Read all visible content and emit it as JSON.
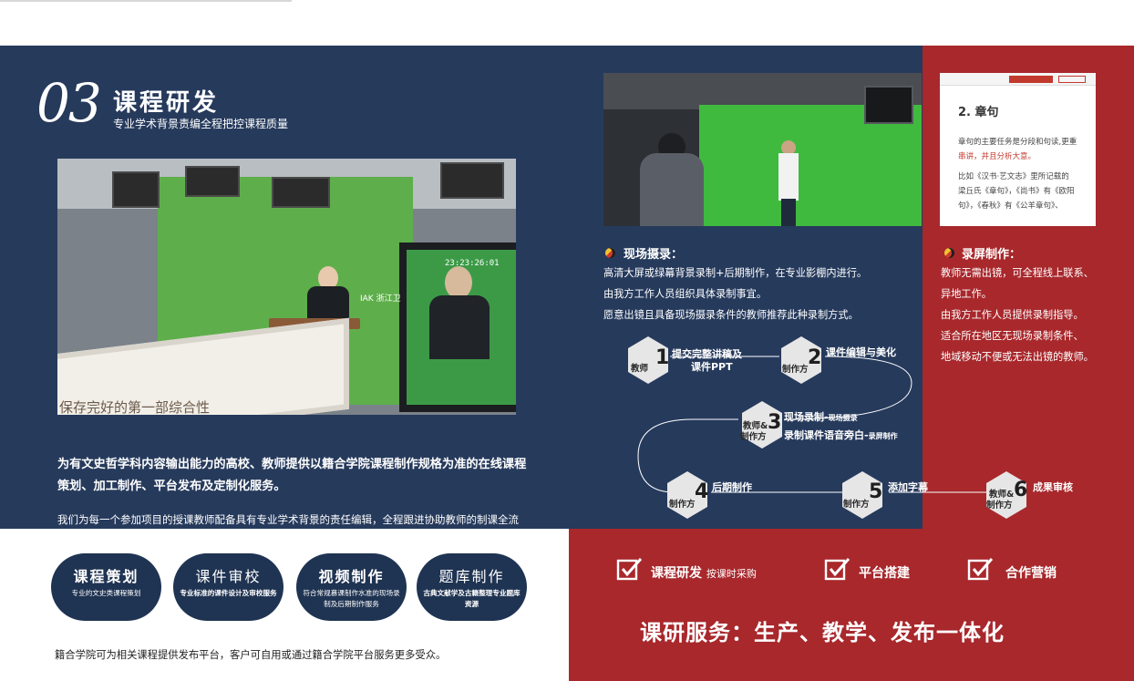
{
  "heading": {
    "number": "03",
    "title": "课程研发",
    "subtitle": "专业学术背景责编全程把控课程质量"
  },
  "main_photo": {
    "book_text": "保存完好的第一部综合性",
    "monitor_label": "IAK 浙江卫",
    "timecode": "23:23:26:01"
  },
  "intro": {
    "bold": "为有文史哲学科内容输出能力的高校、教师提供以籍合学院课程制作规格为准的在线课程策划、加工制作、平台发布及定制化服务。",
    "normal": "我们为每一个参加项目的授课教师配备具有专业学术背景的责任编辑，全程跟进协助教师的制课全流程，协调内容策划、编辑审校及后期制作事宜。"
  },
  "onsite": {
    "title": "现场摄录：",
    "lines": [
      "高清大屏或绿幕背景录制+后期制作，在专业影棚内进行。",
      "由我方工作人员组织具体录制事宜。",
      "愿意出镜且具备现场摄录条件的教师推荐此种录制方式。"
    ]
  },
  "screen": {
    "title": "录屏制作：",
    "lines": [
      "教师无需出镜，可全程线上联系、",
      "异地工作。",
      "由我方工作人员提供录制指导。",
      "适合所在地区无现场录制条件、",
      "地域移动不便或无法出镜的教师。"
    ],
    "shot_heading": "2. 章句",
    "shot_line1": "章句的主要任务是分段和句读,更重",
    "shot_line2": "串讲，并且分析大意。",
    "shot_line3": "比如《汉书·艺文志》里所记载的",
    "shot_line4": "梁丘氏《章句》，《尚书》有《欧阳",
    "shot_line5": "句》，《春秋》有《公羊章句》、"
  },
  "steps": [
    {
      "num": "1",
      "role": "教师",
      "text": "提交完整讲稿及",
      "text2": "课件PPT"
    },
    {
      "num": "2",
      "role": "制作方",
      "text": "课件编辑与美化",
      "text2": ""
    },
    {
      "num": "3",
      "role": "教师&",
      "role2": "制作方",
      "text": "现场录制-",
      "small1": "现场摄录",
      "text2": "录制课件语音旁白-",
      "small2": "录屏制作"
    },
    {
      "num": "4",
      "role": "制作方",
      "text": "后期制作",
      "text2": ""
    },
    {
      "num": "5",
      "role": "制作方",
      "text": "添加字幕",
      "text2": ""
    },
    {
      "num": "6",
      "role": "教师&",
      "role2": "制作方",
      "text": "成果审核",
      "text2": ""
    }
  ],
  "pills": [
    {
      "title": "课程策划",
      "sub": "专业的文史类课程策划"
    },
    {
      "title": "课件审校",
      "sub": "专业标准的课件设计及审校服务"
    },
    {
      "title": "视频制作",
      "sub": "符合常规慕课制作水准的现场录制及后期制作服务"
    },
    {
      "title": "题库制作",
      "sub": "古典文献学及古籍整理专业题库资源"
    }
  ],
  "footer_note": "籍合学院可为相关课程提供发布平台，客户可自用或通过籍合学院平台服务更多受众。",
  "features": [
    {
      "label": "课程研发",
      "note": "按课时采购"
    },
    {
      "label": "平台搭建",
      "note": ""
    },
    {
      "label": "合作营销",
      "note": ""
    }
  ],
  "slogan": "课研服务：生产、教学、发布一体化",
  "colors": {
    "navy": "#263a5c",
    "red": "#a8282c",
    "pill": "#1f3352"
  }
}
